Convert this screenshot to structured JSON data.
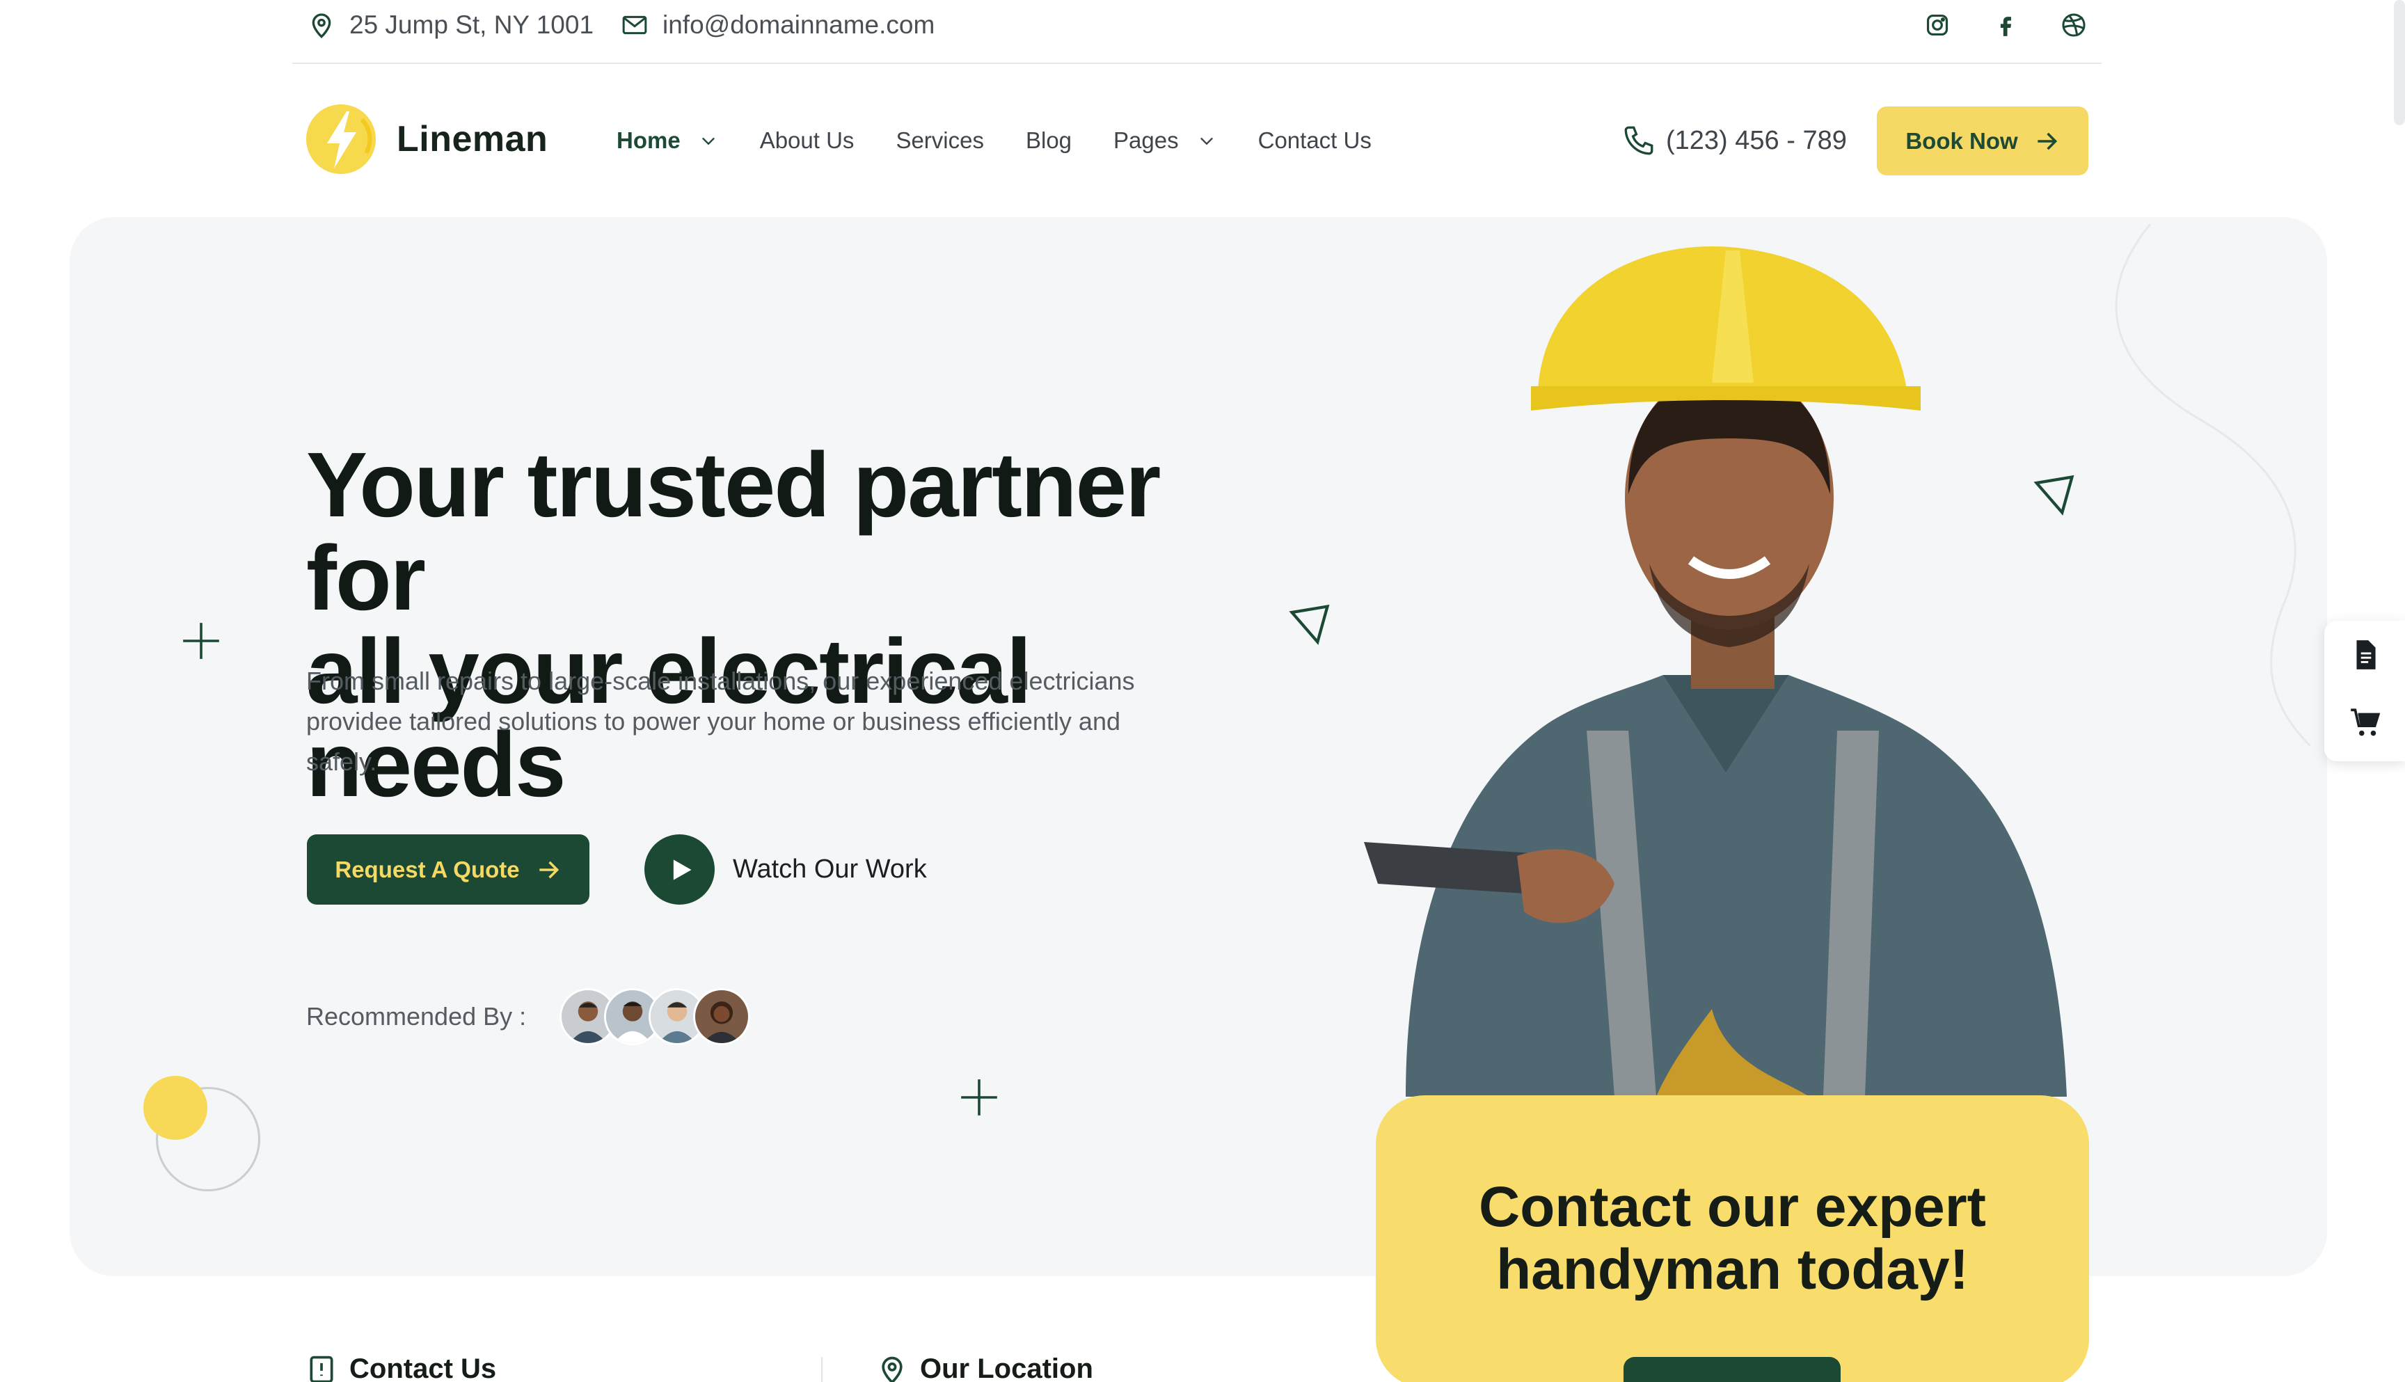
{
  "topbar": {
    "address": "25 Jump St, NY 1001",
    "email": "info@domainname.com",
    "social_icons": [
      "instagram-icon",
      "facebook-icon",
      "dribbble-icon"
    ]
  },
  "header": {
    "logo_text": "Lineman",
    "nav": [
      {
        "label": "Home",
        "dropdown": true,
        "active": true
      },
      {
        "label": "About Us",
        "dropdown": false
      },
      {
        "label": "Services",
        "dropdown": false
      },
      {
        "label": "Blog",
        "dropdown": false
      },
      {
        "label": "Pages",
        "dropdown": true
      },
      {
        "label": "Contact Us",
        "dropdown": false
      }
    ],
    "phone": "(123) 456 - 789",
    "book_label": "Book Now"
  },
  "hero": {
    "title_line1": "Your trusted partner for",
    "title_line2": "all your electrical needs",
    "description": "From small repairs to large-scale installations, our experienced electricians providee tailored solutions to power your home or business efficiently and safely.",
    "quote_label": "Request A Quote",
    "watch_label": "Watch Our Work",
    "recommended_label": "Recommended By :"
  },
  "cta": {
    "title_line1": "Contact our expert",
    "title_line2": "handyman today!"
  },
  "lower": {
    "contact_label": "Contact Us",
    "location_label": "Our Location"
  },
  "colors": {
    "primary": "#1b4934",
    "accent": "#f6d964",
    "hero_bg": "#f4f6f8"
  }
}
